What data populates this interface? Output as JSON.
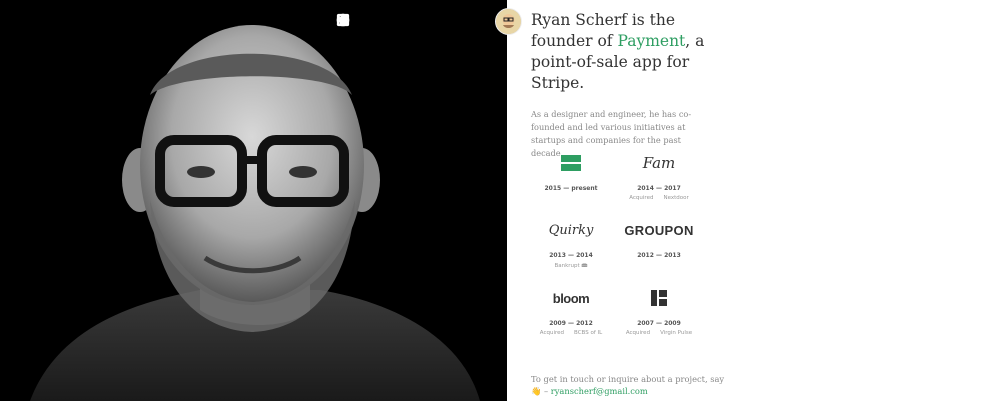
{
  "headline": {
    "before": "Ryan Scherf is the founder of ",
    "accent": "Payment",
    "after": ", a point-of-sale app for Stripe."
  },
  "bio": "As a designer and engineer, he has co-founded and led various initiatives at startups and companies for the past decade.",
  "social": [
    {
      "name": "linkedin-icon"
    },
    {
      "name": "angellist-icon"
    },
    {
      "name": "dribbble-icon"
    },
    {
      "name": "github-icon"
    },
    {
      "name": "instagram-icon"
    },
    {
      "name": "twitter-icon"
    }
  ],
  "companies": [
    {
      "logo_text": "",
      "years": "2015 — present",
      "status": "",
      "outcome": ""
    },
    {
      "logo_text": "Fam",
      "years": "2014 — 2017",
      "status": "Acquired",
      "outcome": "Nextdoor"
    },
    {
      "logo_text": "Quirky",
      "years": "2013 — 2014",
      "status": "Bankrupt 📾",
      "outcome": ""
    },
    {
      "logo_text": "GROUPON",
      "years": "2012 — 2013",
      "status": "",
      "outcome": ""
    },
    {
      "logo_text": "bloom",
      "years": "2009 — 2012",
      "status": "Acquired",
      "outcome": "BCBS of IL"
    },
    {
      "logo_text": "",
      "years": "2007 — 2009",
      "status": "Acquired",
      "outcome": "Virgin Pulse"
    }
  ],
  "contact": {
    "text": "To get in touch or inquire about a project, say 👋 –",
    "email": "ryanscherf@gmail.com"
  },
  "colors": {
    "accent": "#2e9e62",
    "photo_bg": "#000000"
  }
}
